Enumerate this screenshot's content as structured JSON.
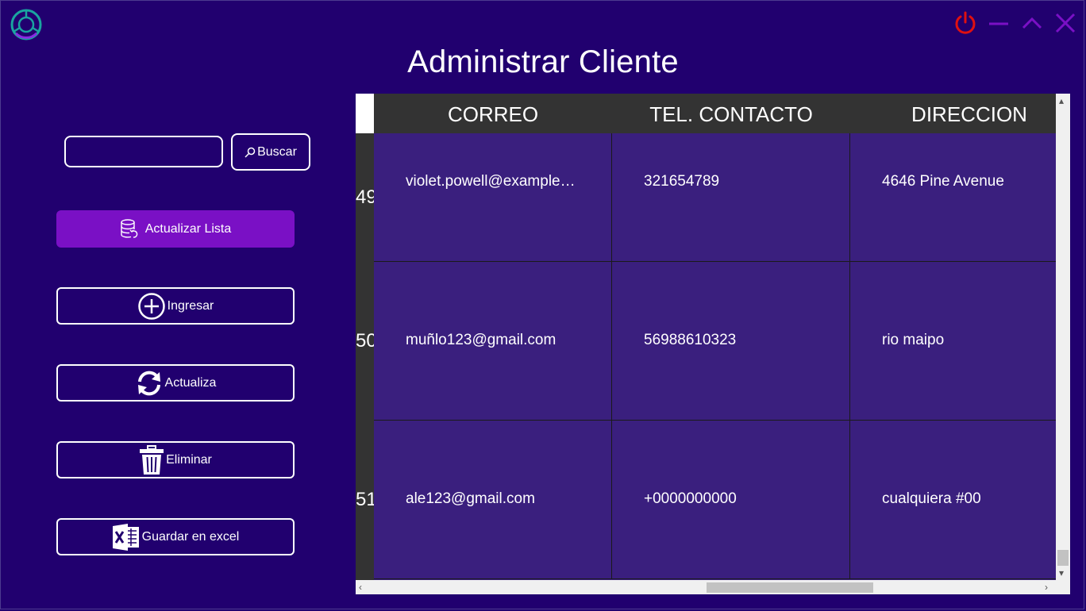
{
  "window": {
    "title": "Administrar Cliente",
    "controls": [
      "power-icon",
      "minimize-icon",
      "maximize-icon",
      "close-icon"
    ],
    "colors": {
      "background": "#21006f",
      "accent": "#7a10c5",
      "power": "#e01010",
      "controls": "#7a10c5"
    }
  },
  "search": {
    "placeholder": "",
    "value": "",
    "button_label": "Buscar"
  },
  "actions": {
    "refresh_label": "Actualizar Lista",
    "add_label": "Ingresar",
    "update_label": "Actualiza",
    "delete_label": "Eliminar",
    "excel_label": "Guardar en  excel"
  },
  "table": {
    "columns": [
      "CORREO",
      "TEL. CONTACTO",
      "DIRECCION"
    ],
    "rows": [
      {
        "id": "49",
        "correo": "violet.powell@example.com",
        "telefono": "321654789",
        "direccion": "4646 Pine Avenue"
      },
      {
        "id": "50",
        "correo": "muñlo123@gmail.com",
        "telefono": "56988610323",
        "direccion": "rio maipo"
      },
      {
        "id": "51",
        "correo": "ale123@gmail.com",
        "telefono": "+0000000000",
        "direccion": "cualquiera #00"
      }
    ],
    "vertical_scroll_position": 1.0,
    "horizontal_scroll_position": 0.5
  }
}
